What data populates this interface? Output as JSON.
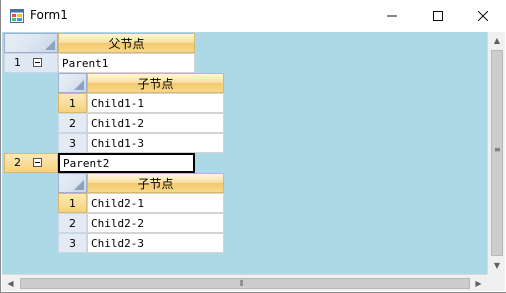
{
  "window": {
    "title": "Form1",
    "icon": "windows-form-icon",
    "minimize_icon": "minimize-icon",
    "maximize_icon": "maximize-icon",
    "close_icon": "close-icon"
  },
  "grid": {
    "background_color": "#add8e6",
    "header_color": "#f8dfa0",
    "parent_header": "父节点",
    "child_header": "子节点",
    "parents": [
      {
        "row_number": "1",
        "value": "Parent1",
        "expanded": true,
        "children": [
          {
            "row_number": "1",
            "value": "Child1-1"
          },
          {
            "row_number": "2",
            "value": "Child1-2"
          },
          {
            "row_number": "3",
            "value": "Child1-3"
          }
        ]
      },
      {
        "row_number": "2",
        "value": "Parent2",
        "expanded": true,
        "selected": true,
        "children": [
          {
            "row_number": "1",
            "value": "Child2-1"
          },
          {
            "row_number": "2",
            "value": "Child2-2"
          },
          {
            "row_number": "3",
            "value": "Child2-3"
          }
        ]
      }
    ]
  }
}
